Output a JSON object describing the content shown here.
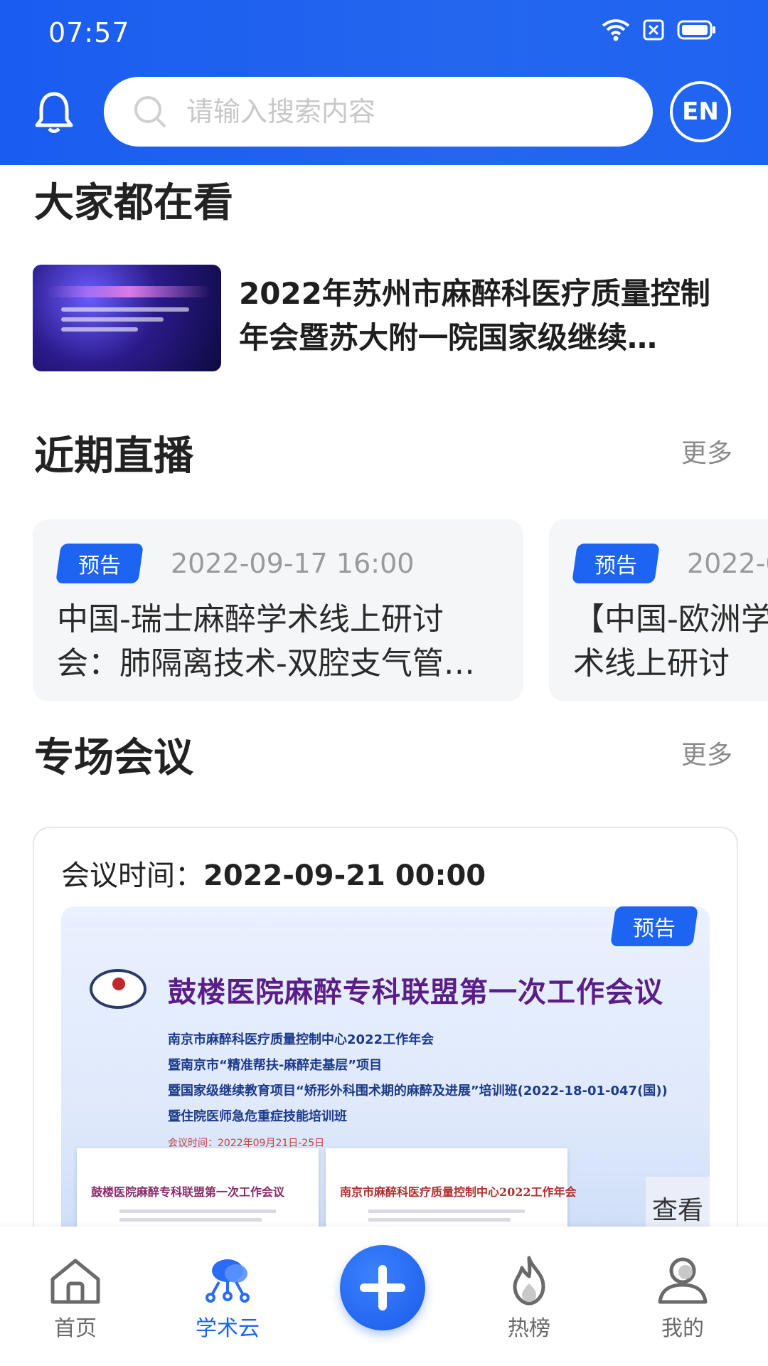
{
  "status": {
    "time": "07:57"
  },
  "header": {
    "search_placeholder": "请输入搜索内容",
    "lang_label": "EN"
  },
  "hot": {
    "title": "大家都在看",
    "items": [
      {
        "title": "2022年苏州市麻醉科医疗质量控制年会暨苏大附一院国家级继续…"
      }
    ]
  },
  "live": {
    "title": "近期直播",
    "more_label": "更多",
    "cards": [
      {
        "badge": "预告",
        "date": "2022-09-17 16:00",
        "title": "中国-瑞士麻醉学术线上研讨会：肺隔离技术-双腔支气管…"
      },
      {
        "badge": "预告",
        "date": "2022-0",
        "title": "【中国-欧洲学术线上研讨"
      }
    ]
  },
  "meeting": {
    "title": "专场会议",
    "more_label": "更多",
    "time_label": "会议时间：",
    "time_value": "2022-09-21 00:00",
    "badge": "预告",
    "banner": {
      "headline": "鼓楼医院麻醉专科联盟第一次工作会议",
      "lines": [
        "南京市麻醉科医疗质量控制中心2022工作年会",
        "暨南京市“精准帮扶-麻醉走基层”项目",
        "暨国家级继续教育项目“矫形外科围术期的麻醉及进展”培训班(2022-18-01-047(国))",
        "暨住院医师急危重症技能培训班"
      ],
      "date": "会议时间：2022年09月21日-25日",
      "slide1_title": "鼓楼医院麻醉专科联盟第一次工作会议",
      "slide2_title": "南京市麻醉科医疗质量控制中心2022工作年会",
      "check_label": "查看"
    }
  },
  "nav": {
    "items": [
      {
        "label": "首页",
        "icon": "home-icon"
      },
      {
        "label": "学术云",
        "icon": "cloud-network-icon",
        "active": true
      },
      {
        "label": "",
        "icon": "plus-icon"
      },
      {
        "label": "热榜",
        "icon": "flame-icon"
      },
      {
        "label": "我的",
        "icon": "user-icon"
      }
    ]
  },
  "colors": {
    "primary": "#1d64f2",
    "header_bg": "#2466ee"
  }
}
